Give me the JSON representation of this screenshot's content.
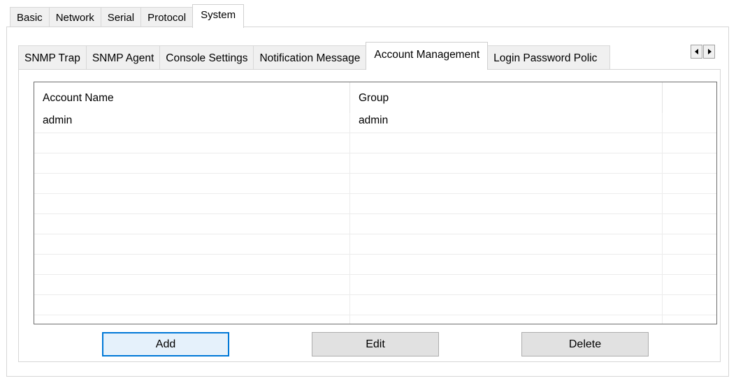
{
  "top_tabs": [
    "Basic",
    "Network",
    "Serial",
    "Protocol",
    "System"
  ],
  "top_tab_active": "System",
  "sub_tabs": [
    "SNMP Trap",
    "SNMP Agent",
    "Console Settings",
    "Notification Message",
    "Account Management",
    "Login Password Polic"
  ],
  "sub_tab_active": "Account Management",
  "table": {
    "columns": [
      "Account Name",
      "Group"
    ],
    "rows": [
      {
        "account_name": "admin",
        "group": "admin"
      }
    ]
  },
  "buttons": {
    "add": "Add",
    "edit": "Edit",
    "delete": "Delete"
  },
  "icons": {
    "scroll_left": "triangle-left-icon",
    "scroll_right": "triangle-right-icon"
  }
}
